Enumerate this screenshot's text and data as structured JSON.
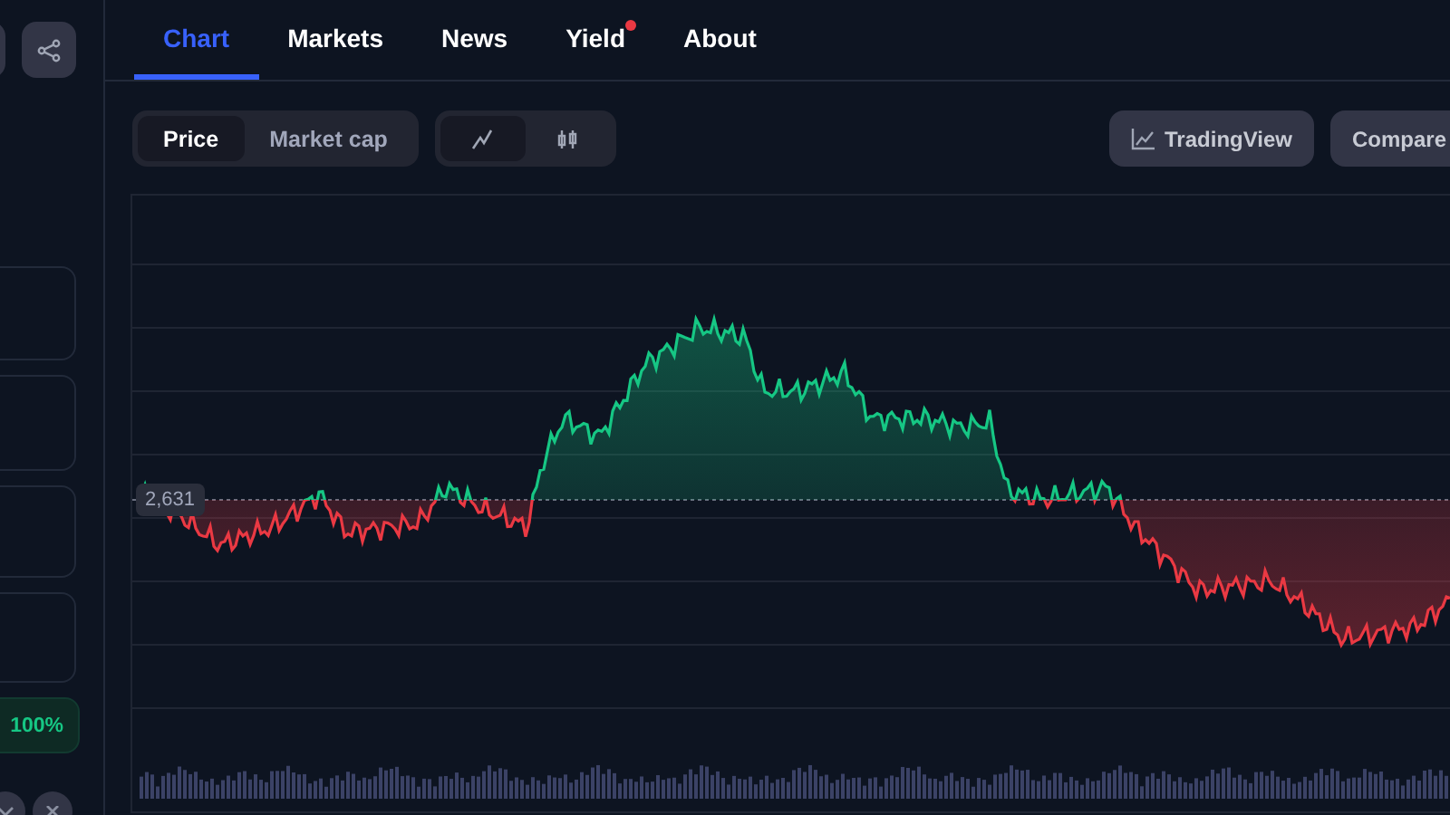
{
  "sidebar": {
    "stat_badge": "100%"
  },
  "tabs": [
    {
      "label": "Chart",
      "selected": true,
      "dot": false
    },
    {
      "label": "Markets",
      "selected": false,
      "dot": false
    },
    {
      "label": "News",
      "selected": false,
      "dot": false
    },
    {
      "label": "Yield",
      "selected": false,
      "dot": true
    },
    {
      "label": "About",
      "selected": false,
      "dot": false
    }
  ],
  "metric_toggle": [
    {
      "label": "Price",
      "selected": true
    },
    {
      "label": "Market cap",
      "selected": false
    }
  ],
  "chart_type_toggle": [
    {
      "kind": "line",
      "selected": true
    },
    {
      "kind": "candles",
      "selected": false
    }
  ],
  "buttons": [
    {
      "label": "TradingView",
      "kind": "tradingview"
    },
    {
      "label": "Compare",
      "kind": "plain"
    }
  ],
  "chart": {
    "baseline_label": "2,631"
  }
}
